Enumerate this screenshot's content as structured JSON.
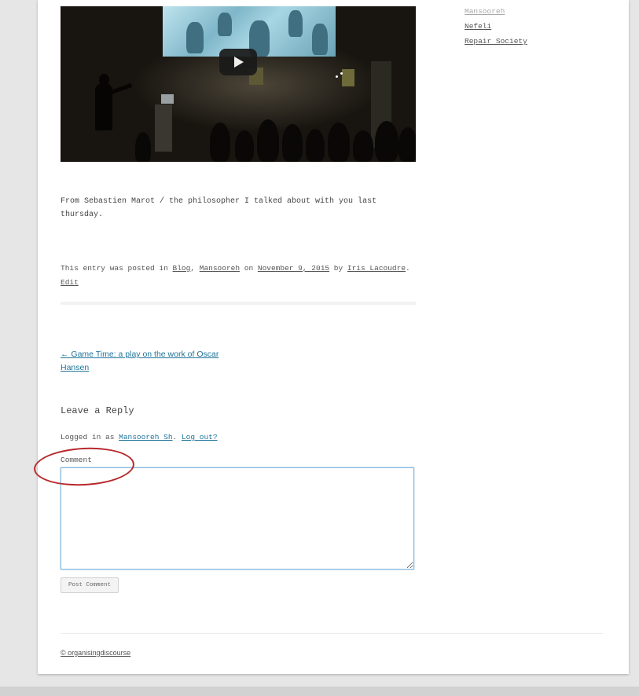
{
  "sidebar": {
    "links": [
      "Mansooreh",
      "Nefeli",
      "Repair Society"
    ]
  },
  "video": {
    "play_icon": "play-icon"
  },
  "entry": {
    "body": "From Sebastien Marot / the philosopher I talked about with you last thursday.",
    "meta_prefix": "This entry was posted in ",
    "category_1": "Blog",
    "comma": ", ",
    "category_2": "Mansooreh",
    "on": " on ",
    "date": "November 9, 2015",
    "by": " by ",
    "author": "Iris Lacoudre",
    "period": ".",
    "edit": "Edit"
  },
  "navigation": {
    "previous_post": "← Game Time: a play on the work of Oscar Hansen"
  },
  "reply": {
    "title": "Leave a Reply",
    "logged_in_prefix": "Logged in as ",
    "user": "Mansooreh Sh",
    "separator": ". ",
    "logout": "Log out?",
    "comment_label": "Comment",
    "comment_value": "",
    "submit_label": "Post Comment"
  },
  "footer": {
    "credit": "© organisingdiscourse"
  },
  "colors": {
    "link_blue": "#21759b",
    "annotation_red": "#b8282c",
    "focus_border": "#82b5dd"
  }
}
